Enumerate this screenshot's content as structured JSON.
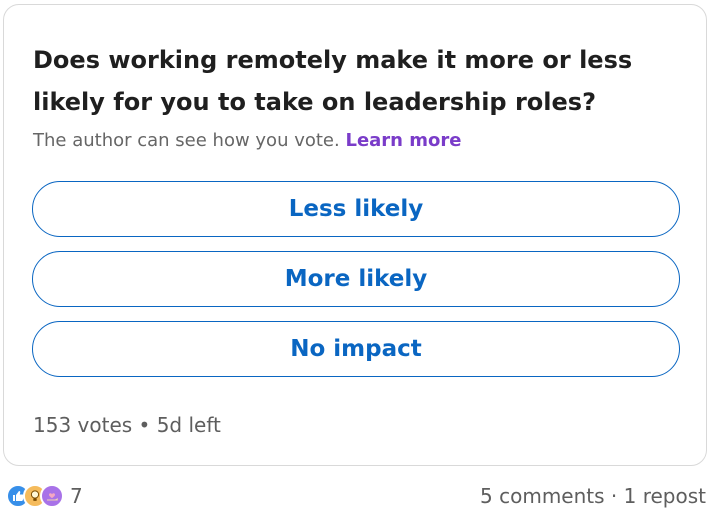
{
  "poll": {
    "question": "Does working remotely make it more or less likely for you to take on leadership roles?",
    "visibility_note": "The author can see how you vote.",
    "learn_more": "Learn more",
    "options": [
      {
        "label": "Less likely"
      },
      {
        "label": "More likely"
      },
      {
        "label": "No impact"
      }
    ],
    "votes": "153 votes",
    "separator": "•",
    "time_left": "5d left"
  },
  "social": {
    "reaction_icons": [
      "like-icon",
      "insightful-bulb-icon",
      "support-heart-hand-icon"
    ],
    "reaction_count": "7",
    "comments": "5 comments",
    "dot": "·",
    "reposts": "1 repost"
  },
  "colors": {
    "accent": "#0a66c2",
    "link": "#7a3cc9",
    "text_primary": "#1f1f1f",
    "text_secondary": "#666666"
  }
}
